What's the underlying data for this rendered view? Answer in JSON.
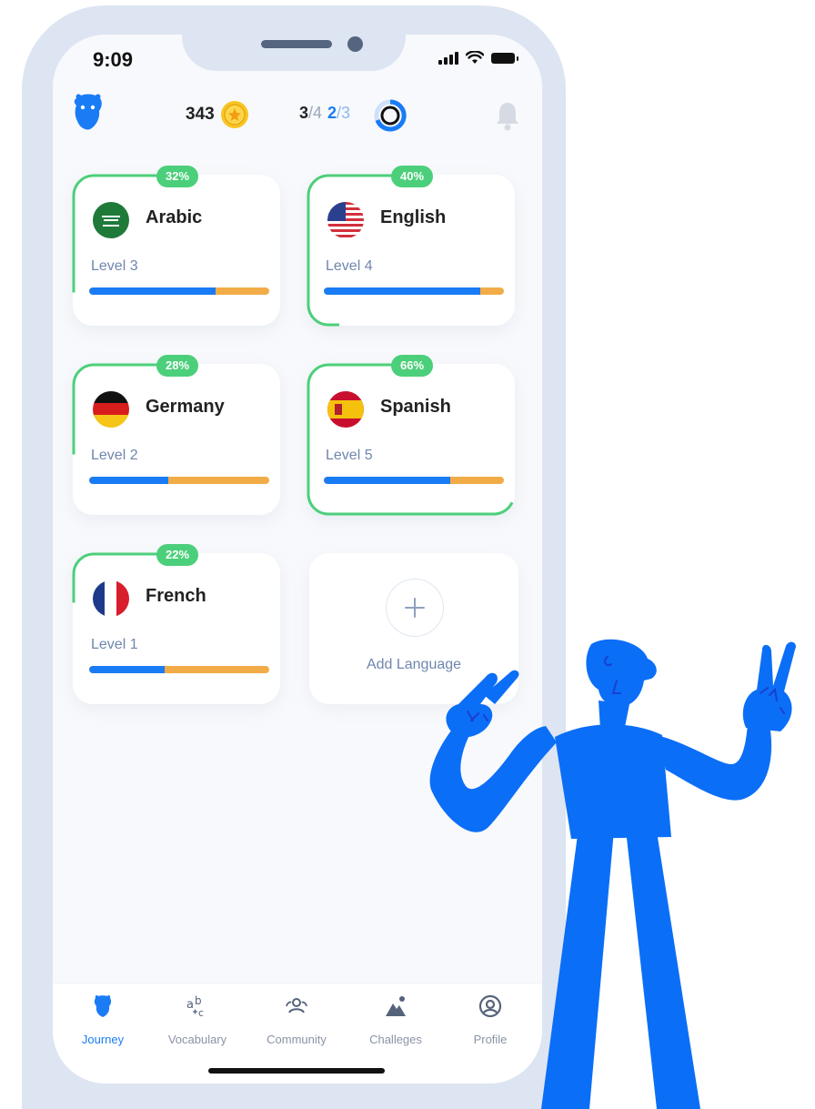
{
  "status_bar": {
    "time": "9:09"
  },
  "header": {
    "coins": "343",
    "lessons_done": "3",
    "lessons_total": "/4",
    "goals_done": "2",
    "goals_total": "/3",
    "icons": [
      "logo-icon",
      "star-coin-icon",
      "progress-ring-icon",
      "bell-icon"
    ]
  },
  "languages": [
    {
      "name": "Arabic",
      "level": "Level 3",
      "percent": "32%",
      "progress": 0.32,
      "bar_blue": 0.7
    },
    {
      "name": "English",
      "level": "Level 4",
      "percent": "40%",
      "progress": 0.4,
      "bar_blue": 0.87
    },
    {
      "name": "Germany",
      "level": "Level 2",
      "percent": "28%",
      "progress": 0.28,
      "bar_blue": 0.44
    },
    {
      "name": "Spanish",
      "level": "Level 5",
      "percent": "66%",
      "progress": 0.66,
      "bar_blue": 0.7
    },
    {
      "name": "French",
      "level": "Level 1",
      "percent": "22%",
      "progress": 0.22,
      "bar_blue": 0.42
    }
  ],
  "add_language": {
    "label": "Add Language"
  },
  "tabs": [
    {
      "label": "Journey",
      "icon": "bear-icon",
      "active": true
    },
    {
      "label": "Vocabulary",
      "icon": "abc-icon",
      "active": false
    },
    {
      "label": "Community",
      "icon": "community-icon",
      "active": false
    },
    {
      "label": "Challeges",
      "icon": "mountain-icon",
      "active": false
    },
    {
      "label": "Profile",
      "icon": "profile-icon",
      "active": false
    }
  ],
  "colors": {
    "accent": "#1a7cf5",
    "progress_green": "#4ccf7a",
    "bar_orange": "#f2ac47",
    "figure_blue": "#0b6ef7"
  }
}
